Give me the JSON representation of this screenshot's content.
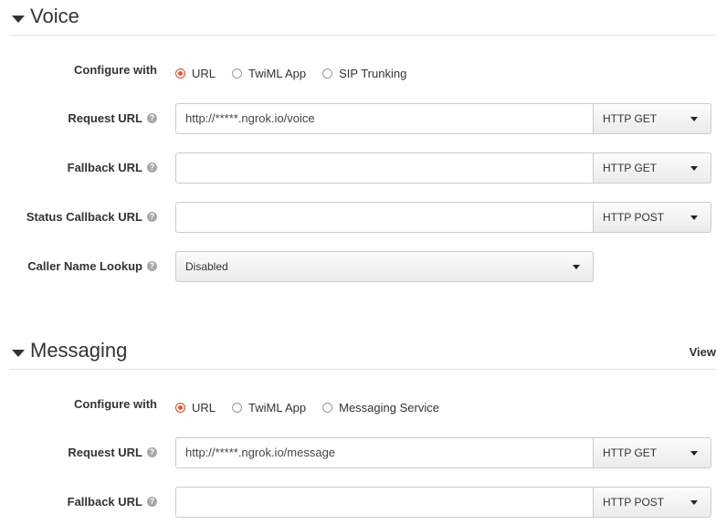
{
  "voice": {
    "title": "Voice",
    "configure_label": "Configure with",
    "radios": [
      "URL",
      "TwiML App",
      "SIP Trunking"
    ],
    "request_url_label": "Request URL",
    "request_url_value": "http://*****.ngrok.io/voice",
    "request_method": "HTTP GET",
    "fallback_url_label": "Fallback URL",
    "fallback_url_value": "",
    "fallback_method": "HTTP GET",
    "status_label": "Status Callback URL",
    "status_value": "",
    "status_method": "HTTP POST",
    "caller_lookup_label": "Caller Name Lookup",
    "caller_lookup_value": "Disabled"
  },
  "messaging": {
    "title": "Messaging",
    "view_link": "View",
    "configure_label": "Configure with",
    "radios": [
      "URL",
      "TwiML App",
      "Messaging Service"
    ],
    "request_url_label": "Request URL",
    "request_url_value": "http://*****.ngrok.io/message",
    "request_method": "HTTP GET",
    "fallback_url_label": "Fallback URL",
    "fallback_url_value": "",
    "fallback_method": "HTTP POST"
  },
  "help_glyph": "?",
  "colors": {
    "radio_selected": "#e8562c",
    "text": "#333333",
    "divider": "#e3e3e3"
  }
}
